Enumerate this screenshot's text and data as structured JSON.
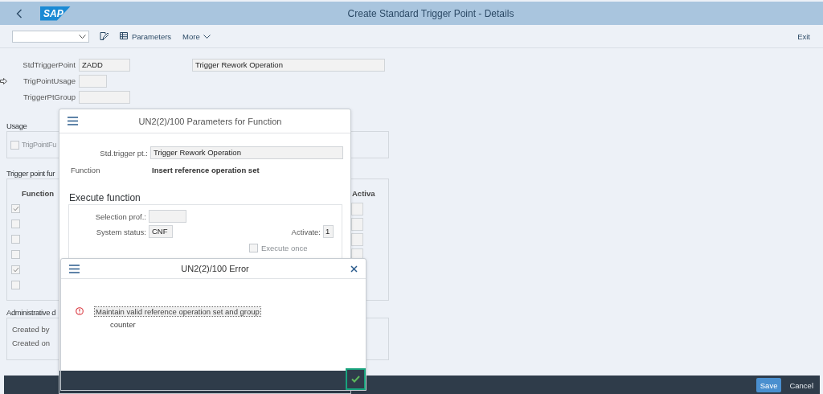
{
  "header": {
    "logo": "SAP",
    "title": "Create Standard Trigger Point - Details"
  },
  "toolbar": {
    "buttons": [
      {
        "label": "Parameters",
        "kind": "grid"
      },
      {
        "label": "More",
        "kind": "menu"
      }
    ],
    "exit": "Exit"
  },
  "fields": [
    {
      "label": "StdTriggerPoint",
      "value": "ZADD",
      "description": "Trigger Rework Operation",
      "pointer": false
    },
    {
      "label": "TrigPointUsage",
      "pointer": true
    },
    {
      "label": "TriggerPtGroup",
      "pointer": false
    }
  ],
  "usage": {
    "title": "Usage",
    "options": [
      {
        "label": "TrigPointFu",
        "checked": false
      }
    ]
  },
  "functions": {
    "title": "Trigger point fur",
    "columns": [
      "Function",
      "Activa"
    ],
    "rows": [
      {
        "checked": true,
        "activa_field": true
      },
      {
        "checked": false,
        "activa_field": true
      },
      {
        "checked": false,
        "activa_field": true
      },
      {
        "checked": false,
        "activa_field": true
      },
      {
        "checked": true
      },
      {
        "checked": false
      }
    ]
  },
  "admin": {
    "title": "Administrative d",
    "fields": [
      "Created by",
      "Created on"
    ]
  },
  "footer": {
    "buttons": [
      {
        "label": "Save",
        "kind": "primary"
      },
      {
        "label": "Cancel",
        "kind": "plain"
      }
    ]
  },
  "params_dialog": {
    "title": "UN2(2)/100 Parameters for Function",
    "trigger_label": "Std.trigger pt.:",
    "trigger_value": "Trigger Rework Operation",
    "function_label": "Function",
    "function_value": "Insert reference operation set",
    "section_title": "Execute function",
    "selection_label": "Selection prof.:",
    "status_label": "System status:",
    "status_value": "CNF",
    "activate_label": "Activate:",
    "activate_value": "1",
    "execute_once": {
      "label": "Execute once",
      "checked": false
    }
  },
  "error_dialog": {
    "title": "UN2(2)/100 Error",
    "lines": [
      {
        "text": "Maintain valid reference operation set and group",
        "focused": true
      },
      {
        "text": "counter",
        "focused": false
      }
    ]
  }
}
